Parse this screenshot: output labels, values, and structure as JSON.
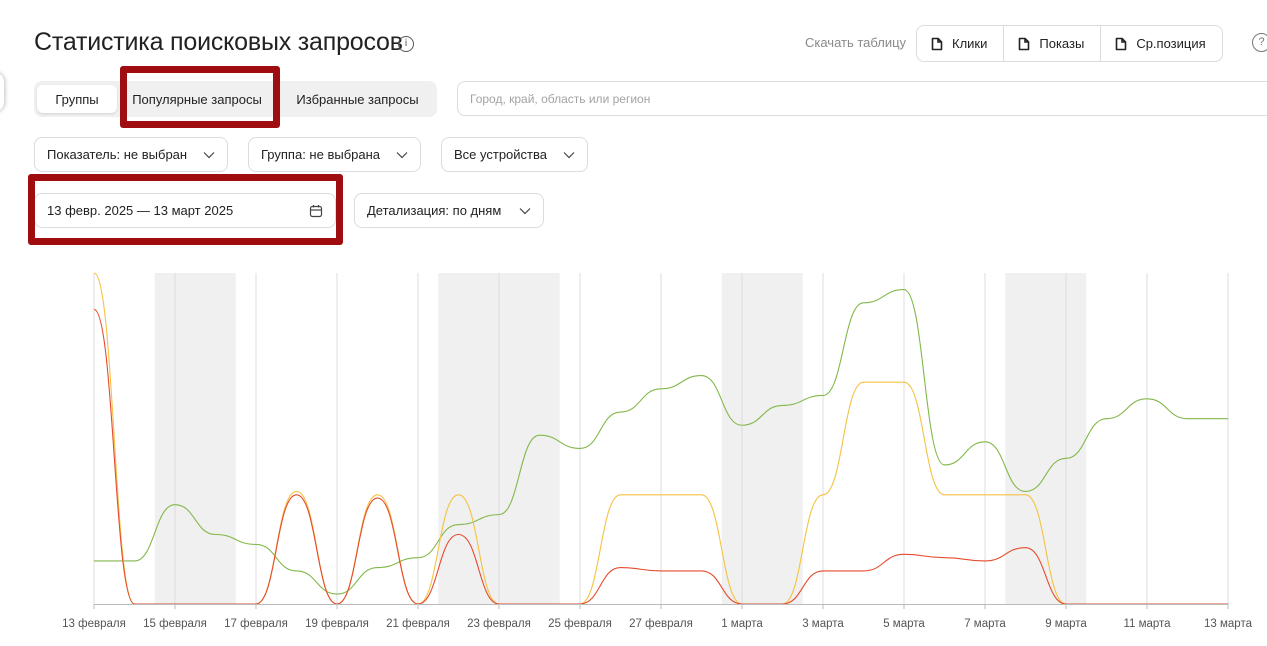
{
  "header": {
    "title": "Статистика поисковых запросов",
    "download_label": "Скачать таблицу",
    "metric_buttons": [
      {
        "label": "Клики"
      },
      {
        "label": "Показы"
      },
      {
        "label": "Ср.позиция"
      }
    ]
  },
  "tabs": [
    {
      "label": "Группы",
      "active": true
    },
    {
      "label": "Популярные запросы",
      "active": false
    },
    {
      "label": "Избранные запросы",
      "active": false
    }
  ],
  "search": {
    "placeholder": "Город, край, область или регион",
    "value": ""
  },
  "filters": {
    "indicator": "Показатель: не выбран",
    "group": "Группа: не выбрана",
    "devices": "Все устройства",
    "date_range": "13 февр. 2025 — 13 март 2025",
    "detail": "Детализация: по дням"
  },
  "colors": {
    "highlight": "#a00d10",
    "weekend_band": "#f0f0f0",
    "series_green": "#82b84a",
    "series_yellow": "#f5c242",
    "series_red": "#e64a2e"
  },
  "chart_data": {
    "type": "line",
    "x": [
      "2025-02-13",
      "2025-02-14",
      "2025-02-15",
      "2025-02-16",
      "2025-02-17",
      "2025-02-18",
      "2025-02-19",
      "2025-02-20",
      "2025-02-21",
      "2025-02-22",
      "2025-02-23",
      "2025-02-24",
      "2025-02-25",
      "2025-02-26",
      "2025-02-27",
      "2025-02-28",
      "2025-03-01",
      "2025-03-02",
      "2025-03-03",
      "2025-03-04",
      "2025-03-05",
      "2025-03-06",
      "2025-03-07",
      "2025-03-08",
      "2025-03-09",
      "2025-03-10",
      "2025-03-11",
      "2025-03-12",
      "2025-03-13"
    ],
    "tick_labels": [
      "13 февраля",
      "15 февраля",
      "17 февраля",
      "19 февраля",
      "21 февраля",
      "23 февраля",
      "25 февраля",
      "27 февраля",
      "1 марта",
      "3 марта",
      "5 марта",
      "7 марта",
      "9 марта",
      "11 марта",
      "13 марта"
    ],
    "weekends": [
      [
        "2025-02-15",
        "2025-02-16"
      ],
      [
        "2025-02-22",
        "2025-02-24"
      ],
      [
        "2025-03-01",
        "2025-03-02"
      ],
      [
        "2025-03-08",
        "2025-03-09"
      ]
    ],
    "ylim": [
      0,
      100
    ],
    "grid": true,
    "legend": "none",
    "series": [
      {
        "color": "green",
        "values": [
          13,
          13,
          30,
          21,
          18,
          10,
          3,
          11,
          14,
          24,
          27,
          51,
          47,
          58,
          65,
          69,
          54,
          60,
          63,
          91,
          95,
          42,
          49,
          34,
          44,
          56,
          62,
          56,
          56
        ]
      },
      {
        "color": "yellow",
        "values": [
          100,
          0,
          0,
          0,
          0,
          34,
          0,
          33,
          0,
          33,
          0,
          0,
          0,
          33,
          33,
          33,
          0,
          0,
          33,
          67,
          67,
          33,
          33,
          33,
          0,
          0,
          0,
          0,
          0
        ]
      },
      {
        "color": "red",
        "values": [
          89,
          0,
          0,
          0,
          0,
          33,
          0,
          32,
          0,
          21,
          0,
          0,
          0,
          11,
          10,
          10,
          0,
          0,
          10,
          10,
          15,
          14,
          13,
          17,
          0,
          0,
          0,
          0,
          0
        ]
      }
    ]
  }
}
